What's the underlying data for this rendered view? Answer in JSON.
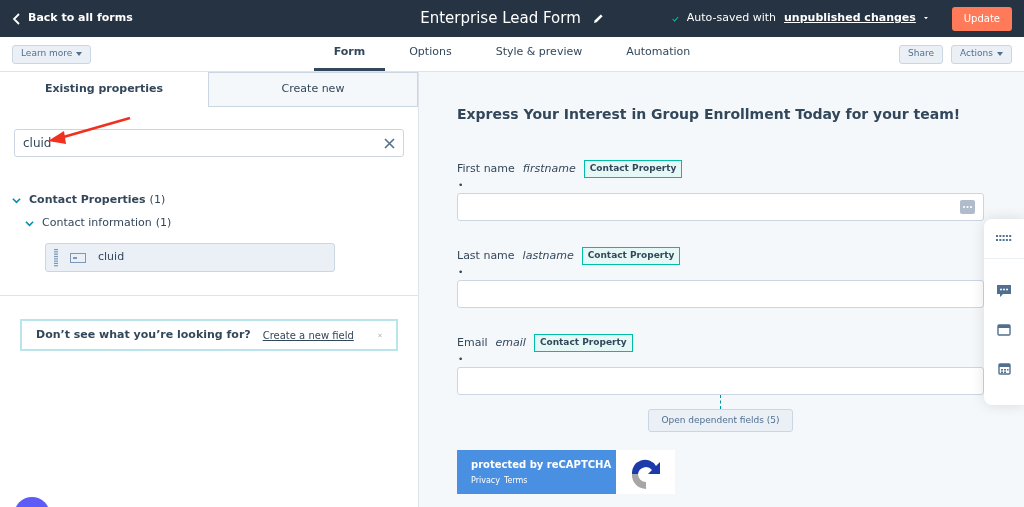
{
  "header": {
    "back_link": "Back to all forms",
    "title": "Enterprise Lead Form",
    "save_status": "Auto-saved with",
    "save_status_link": "unpublished changes",
    "update_button": "Update"
  },
  "toolbar": {
    "learn_more": "Learn more",
    "tabs": [
      {
        "label": "Form",
        "selected": true
      },
      {
        "label": "Options",
        "selected": false
      },
      {
        "label": "Style & preview",
        "selected": false
      },
      {
        "label": "Automation",
        "selected": false
      }
    ],
    "share": "Share",
    "actions": "Actions"
  },
  "left_panel": {
    "tabs": [
      {
        "label": "Existing properties",
        "selected": true
      },
      {
        "label": "Create new",
        "selected": false
      }
    ],
    "search": {
      "value": "cluid"
    },
    "tree": [
      {
        "label": "Contact Properties",
        "count": "(1)",
        "expanded": true,
        "children": [
          {
            "label": "Contact information",
            "count": "(1)",
            "expanded": true,
            "children": [
              {
                "label": "cluid"
              }
            ]
          }
        ]
      }
    ],
    "notice": {
      "text": "Don’t see what you’re looking for?",
      "link": "Create a new field"
    }
  },
  "form_preview": {
    "heading": "Express Your Interest in Group Enrollment Today for your team!",
    "fields": [
      {
        "label": "First name",
        "internal_name": "firstname",
        "badge": "Contact Property",
        "required_mark": "•",
        "autofill_icon": true
      },
      {
        "label": "Last name",
        "internal_name": "lastname",
        "badge": "Contact Property",
        "required_mark": "•",
        "autofill_icon": false
      },
      {
        "label": "Email",
        "internal_name": "email",
        "badge": "Contact Property",
        "required_mark": "•",
        "autofill_icon": false
      }
    ],
    "dependent_button": "Open dependent fields (5)",
    "recaptcha": {
      "text": "protected by reCAPTCHA",
      "privacy": "Privacy",
      "terms": "Terms"
    }
  }
}
